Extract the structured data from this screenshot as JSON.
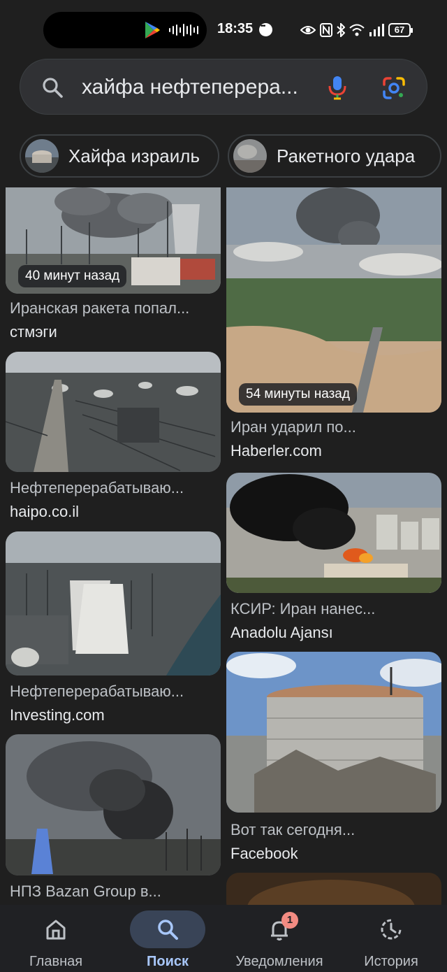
{
  "status_bar": {
    "time": "18:35",
    "battery": "67",
    "icons": [
      "play-store-icon",
      "sound-wave-icon",
      "chat-icon",
      "eye-icon",
      "nfc-icon",
      "bluetooth-icon",
      "wifi-icon",
      "signal-icon",
      "battery-icon"
    ]
  },
  "search": {
    "query": "хайфа нефтеперера..."
  },
  "chips": [
    {
      "label": "Хайфа израиль"
    },
    {
      "label": "Ракетного удара"
    }
  ],
  "results": [
    {
      "badge": "40 минут назад",
      "title": "Иранская ракета попал...",
      "source": "стмэги"
    },
    {
      "badge": "54 минуты назад",
      "title": "Иран ударил по...",
      "source": "Haberler.com"
    },
    {
      "title": "Нефтеперерабатываю...",
      "source": "haipo.co.il"
    },
    {
      "title": "КСИР: Иран нанес...",
      "source": "Anadolu Ajansı"
    },
    {
      "title": "Нефтеперерабатываю...",
      "source": "Investing.com"
    },
    {
      "title": "Вот так сегодня...",
      "source": "Facebook"
    },
    {
      "title": "НПЗ Bazan Group в...",
      "source": ""
    }
  ],
  "bottom_nav": [
    {
      "label": "Главная",
      "icon": "home-icon",
      "active": false
    },
    {
      "label": "Поиск",
      "icon": "search-icon",
      "active": true
    },
    {
      "label": "Уведомления",
      "icon": "bell-icon",
      "active": false,
      "badge": "1"
    },
    {
      "label": "История",
      "icon": "history-icon",
      "active": false
    }
  ],
  "colors": {
    "background": "#1f1f1f",
    "search_bg": "#303134",
    "active_nav": "#394457",
    "active_label": "#a8c7fa",
    "badge": "#f28b82"
  }
}
